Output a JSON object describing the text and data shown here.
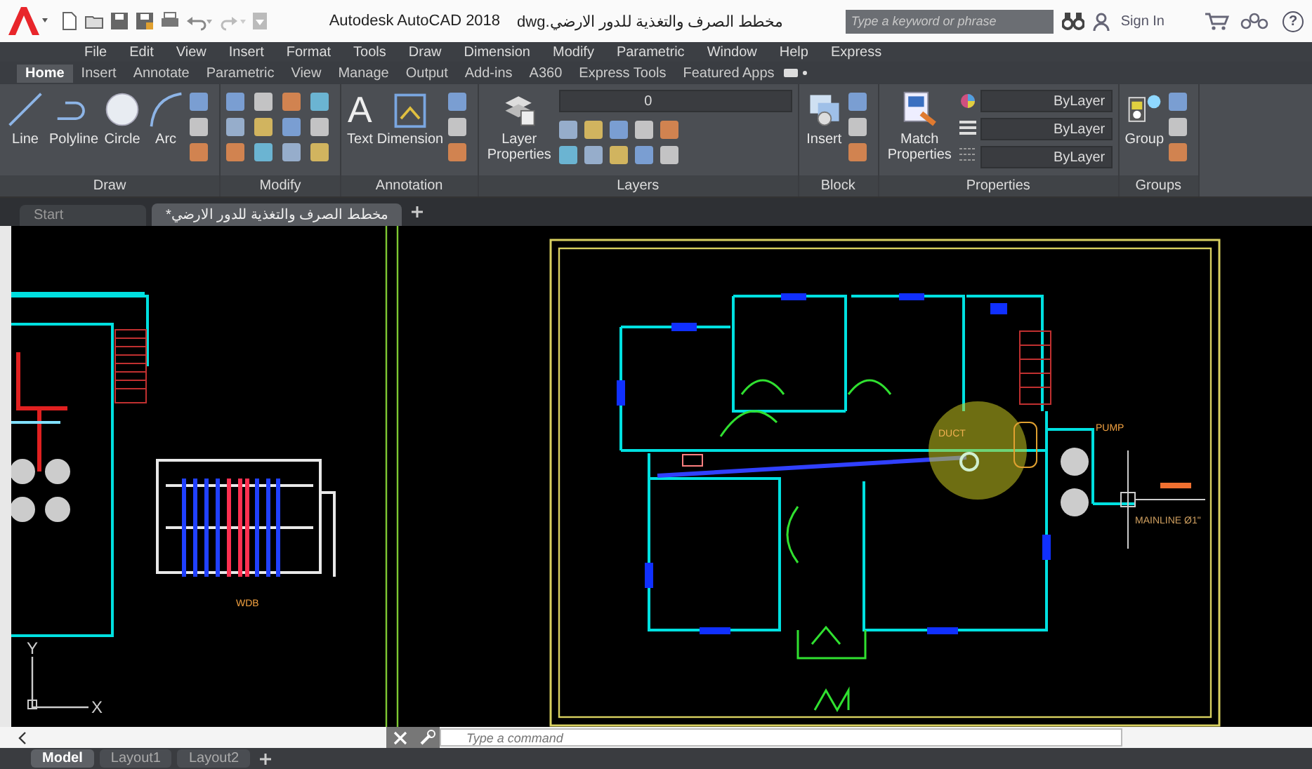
{
  "title_bar": {
    "product": "Autodesk AutoCAD 2018",
    "file_name": "مخطط الصرف والتغذية للدور الارضي.dwg",
    "search": {
      "placeholder": "Type a keyword or phrase"
    },
    "sign_in": "Sign In",
    "help": "?"
  },
  "menu_bar": [
    "File",
    "Edit",
    "View",
    "Insert",
    "Format",
    "Tools",
    "Draw",
    "Dimension",
    "Modify",
    "Parametric",
    "Window",
    "Help",
    "Express"
  ],
  "ribbon_tabs": [
    {
      "label": "Home",
      "selected": true
    },
    {
      "label": "Insert",
      "selected": false
    },
    {
      "label": "Annotate",
      "selected": false
    },
    {
      "label": "Parametric",
      "selected": false
    },
    {
      "label": "View",
      "selected": false
    },
    {
      "label": "Manage",
      "selected": false
    },
    {
      "label": "Output",
      "selected": false
    },
    {
      "label": "Add-ins",
      "selected": false
    },
    {
      "label": "A360",
      "selected": false
    },
    {
      "label": "Express Tools",
      "selected": false
    },
    {
      "label": "Featured Apps",
      "selected": false
    }
  ],
  "ribbon_panels": [
    {
      "kind": "draw",
      "title": "Draw",
      "tools": [
        {
          "label": "Line"
        },
        {
          "label": "Polyline"
        },
        {
          "label": "Circle"
        },
        {
          "label": "Arc"
        }
      ]
    },
    {
      "kind": "modify",
      "title": "Modify"
    },
    {
      "kind": "annotation",
      "title": "Annotation",
      "tools": [
        {
          "label": "Text",
          "glyph": "A"
        },
        {
          "label": "Dimension"
        }
      ]
    },
    {
      "kind": "layers",
      "title": "Layers",
      "tools": [
        {
          "label": "Layer Properties"
        }
      ],
      "layer": "0"
    },
    {
      "kind": "block",
      "title": "Block",
      "tools": [
        {
          "label": "Insert"
        }
      ]
    },
    {
      "kind": "properties",
      "title": "Properties",
      "tools": [
        {
          "label": "Match Properties"
        }
      ],
      "color_setting": "ByLayer",
      "linetype": "ByLayer",
      "lineweight": "ByLayer"
    },
    {
      "kind": "groups",
      "title": "Groups",
      "tools": [
        {
          "label": "Group"
        }
      ]
    }
  ],
  "file_tabs": [
    {
      "label": "Start",
      "selected": false
    },
    {
      "label": "مخطط الصرف والتغذية للدور الارضي*",
      "selected": true
    }
  ],
  "drawing": {
    "manifold_label": "WDB",
    "duct_label": "DUCT",
    "pump_label": "PUMP",
    "mainline_label": "MAINLINE Ø1\"",
    "axis_y": "Y",
    "axis_x": "X"
  },
  "command_line": {
    "placeholder": "Type a command"
  },
  "layout_tabs": [
    {
      "label": "Model",
      "selected": true
    },
    {
      "label": "Layout1",
      "selected": false
    },
    {
      "label": "Layout2",
      "selected": false
    }
  ]
}
